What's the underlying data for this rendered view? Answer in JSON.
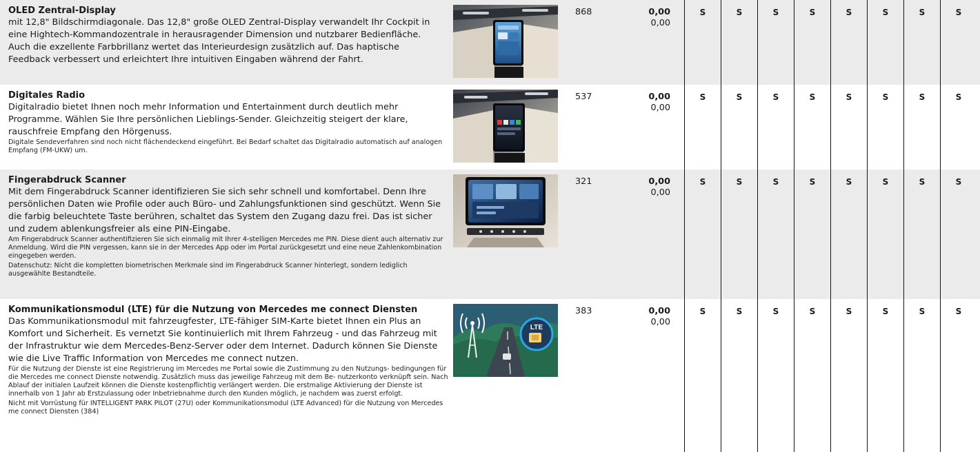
{
  "options": [
    {
      "title": "OLED Zentral-Display",
      "body": "mit 12,8\" Bildschirmdiagonale. Das 12,8\" große OLED Zentral-Display verwandelt Ihr Cockpit in eine Hightech-Kommandozentrale in herausragender Dimension und nutzbarer Bedienfläche. Auch die exzellente Farbbrillanz wertet das Interieurdesign zusätzlich auf. Das haptische Feedback verbessert und erleichtert Ihre intuitiven Eingaben während der Fahrt.",
      "notes": [],
      "code": "868",
      "price_net": "0,00",
      "price_gross": "0,00",
      "availability": [
        "S",
        "S",
        "S",
        "S",
        "S",
        "S",
        "S",
        "S"
      ]
    },
    {
      "title": "Digitales Radio",
      "body": "Digitalradio bietet Ihnen noch mehr Information und Entertainment durch deutlich mehr Programme. Wählen Sie Ihre persönlichen Lieblings-Sender. Gleichzeitig steigert der klare, rauschfreie Empfang den Hörgenuss.",
      "notes": [
        "Digitale Sendeverfahren sind noch nicht flächendeckend eingeführt. Bei Bedarf schaltet das Digitalradio automatisch auf analogen Empfang (FM-UKW) um."
      ],
      "code": "537",
      "price_net": "0,00",
      "price_gross": "0,00",
      "availability": [
        "S",
        "S",
        "S",
        "S",
        "S",
        "S",
        "S",
        "S"
      ]
    },
    {
      "title": "Fingerabdruck Scanner",
      "body": "Mit dem Fingerabdruck Scanner identifizieren Sie sich sehr schnell und komfortabel. Denn Ihre persönlichen Daten wie Profile oder auch Büro- und Zahlungsfunktionen sind geschützt. Wenn Sie die farbig beleuchtete Taste berühren, schaltet das System den Zugang dazu frei. Das ist sicher und zudem ablenkungsfreier als eine PIN-Eingabe.",
      "notes": [
        "Am Fingerabdruck Scanner authentifizieren Sie sich einmalig mit Ihrer 4-stelligen Mercedes me PIN. Diese dient auch alternativ zur Anmeldung. Wird die PIN vergessen, kann sie in der Mercedes App oder im Portal zurückgesetzt und eine neue Zahlenkombination eingegeben werden.",
        "Datenschutz: Nicht die kompletten biometrischen Merkmale sind im Fingerabdruck Scanner hinterlegt, sondern lediglich ausgewählte Bestandteile."
      ],
      "code": "321",
      "price_net": "0,00",
      "price_gross": "0,00",
      "availability": [
        "S",
        "S",
        "S",
        "S",
        "S",
        "S",
        "S",
        "S"
      ]
    },
    {
      "title": "Kommunikationsmodul (LTE) für die Nutzung von Mercedes me connect Diensten",
      "body": "Das Kommunikationsmodul mit fahrzeugfester, LTE-fähiger SIM-Karte bietet Ihnen ein Plus an Komfort und Sicherheit. Es vernetzt Sie kontinuierlich mit Ihrem Fahrzeug - und das Fahrzeug mit der Infrastruktur wie dem Mercedes-Benz-Server oder dem Internet. Dadurch können Sie Dienste wie die Live Traffic Information von Mercedes me connect nutzen.",
      "notes": [
        "Für die Nutzung der Dienste ist eine Registrierung im Mercedes me Portal sowie die Zustimmung zu den Nutzungs- bedingungen für die Mercedes me connect Dienste notwendig. Zusätzlich muss das jeweilige Fahrzeug mit dem Be- nutzerkonto verknüpft sein. Nach Ablauf der initialen Laufzeit können die Dienste kostenpflichtig verlängert werden. Die erstmalige Aktivierung der Dienste ist innerhalb von 1 Jahr ab Erstzulassung oder Inbetriebnahme durch den Kunden möglich, je nachdem was zuerst erfolgt.",
        "Nicht mit Vorrüstung für INTELLIGENT PARK PILOT (27U) oder Kommunikationsmodul (LTE Advanced) für die Nutzung von Mercedes me connect Diensten (384)"
      ],
      "image_badge": "LTE",
      "code": "383",
      "price_net": "0,00",
      "price_gross": "0,00",
      "availability": [
        "S",
        "S",
        "S",
        "S",
        "S",
        "S",
        "S",
        "S"
      ]
    }
  ]
}
